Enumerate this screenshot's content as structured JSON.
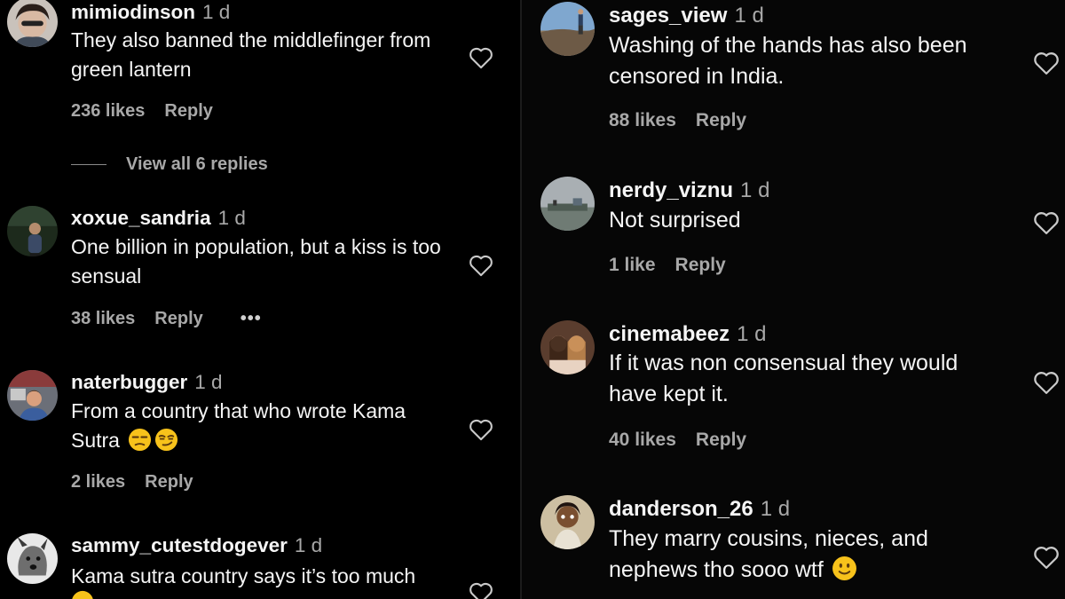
{
  "left_comments": [
    {
      "username": "mimiodinson",
      "time": "1 d",
      "text": "They also banned the middlefinger from green lantern",
      "likes": "236 likes",
      "reply": "Reply",
      "view_replies": "View all 6 replies"
    },
    {
      "username": "xoxue_sandria",
      "time": "1 d",
      "text": "One billion in population, but a kiss is too sensual",
      "likes": "38 likes",
      "reply": "Reply",
      "more": "•••"
    },
    {
      "username": "naterbugger",
      "time": "1 d",
      "text": "From a country that who wrote Kama Sutra",
      "likes": "2 likes",
      "reply": "Reply",
      "emojis": [
        "unamused-face-emoji",
        "smirking-face-emoji"
      ]
    },
    {
      "username": "sammy_cutestdogever",
      "time": "1 d",
      "text": "Kama sutra country says it’s too much"
    }
  ],
  "right_comments": [
    {
      "username": "sages_view",
      "time": "1 d",
      "text": "Washing of the hands has also been censored in India.",
      "likes": "88 likes",
      "reply": "Reply"
    },
    {
      "username": "nerdy_viznu",
      "time": "1 d",
      "text": "Not surprised",
      "likes": "1 like",
      "reply": "Reply"
    },
    {
      "username": "cinemabeez",
      "time": "1 d",
      "text": "If it was non consensual they would have kept it.",
      "likes": "40 likes",
      "reply": "Reply"
    },
    {
      "username": "danderson_26",
      "time": "1 d",
      "text": "They marry cousins, nieces, and nephews tho sooo wtf",
      "emojis": [
        "slightly-smiling-face-emoji"
      ]
    }
  ],
  "icons": {
    "like": "heart-outline-icon",
    "more": "more-options-icon"
  },
  "colors": {
    "background": "#000000",
    "primary_text": "#f5f5f5",
    "secondary_text": "#a8a8a8",
    "emoji_yellow": "#f7c21b"
  }
}
